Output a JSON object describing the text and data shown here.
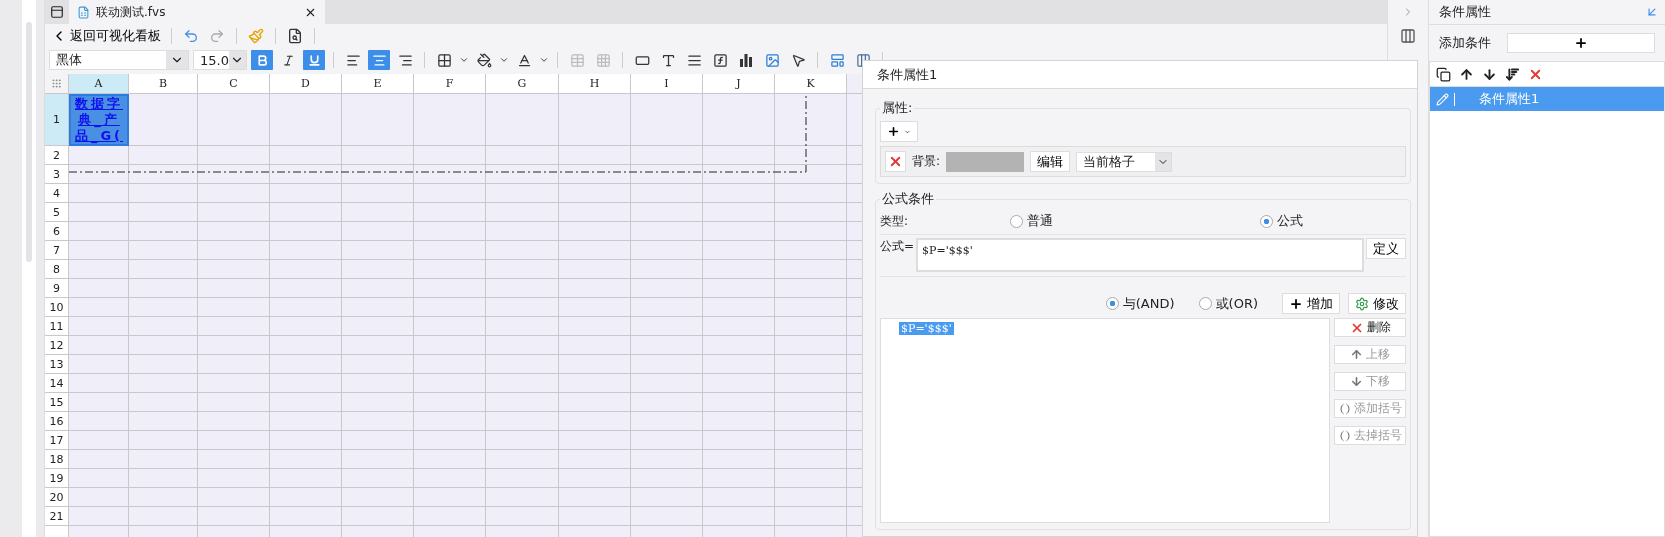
{
  "tab_bar": {
    "tabs": [
      {
        "label": "联动测试.fvs",
        "selected": true
      }
    ]
  },
  "toolbar": {
    "back_label": "返回可视化看板",
    "font_name": "黑体",
    "font_size": "15.0",
    "format_buttons": [
      {
        "kind": "bold",
        "selected": true
      },
      {
        "kind": "italic",
        "selected": false
      },
      {
        "kind": "underline",
        "selected": true
      }
    ],
    "align_buttons": [
      {
        "kind": "left",
        "selected": false
      },
      {
        "kind": "center",
        "selected": true
      },
      {
        "kind": "right",
        "selected": false
      }
    ]
  },
  "sheet": {
    "columns": [
      {
        "label": "A",
        "selected": true
      },
      {
        "label": "B",
        "selected": false
      },
      {
        "label": "C",
        "selected": false
      },
      {
        "label": "D",
        "selected": false
      },
      {
        "label": "E",
        "selected": false
      },
      {
        "label": "F",
        "selected": false
      },
      {
        "label": "G",
        "selected": false
      },
      {
        "label": "H",
        "selected": false
      },
      {
        "label": "I",
        "selected": false
      },
      {
        "label": "J",
        "selected": false
      },
      {
        "label": "K",
        "selected": false
      }
    ],
    "rows": [
      {
        "label": "1",
        "selected": true
      },
      {
        "label": "2",
        "selected": false
      },
      {
        "label": "3",
        "selected": false
      },
      {
        "label": "4",
        "selected": false
      },
      {
        "label": "5",
        "selected": false
      },
      {
        "label": "6",
        "selected": false
      },
      {
        "label": "7",
        "selected": false
      },
      {
        "label": "8",
        "selected": false
      },
      {
        "label": "9",
        "selected": false
      },
      {
        "label": "10",
        "selected": false
      },
      {
        "label": "11",
        "selected": false
      },
      {
        "label": "12",
        "selected": false
      },
      {
        "label": "13",
        "selected": false
      },
      {
        "label": "14",
        "selected": false
      },
      {
        "label": "15",
        "selected": false
      },
      {
        "label": "16",
        "selected": false
      },
      {
        "label": "17",
        "selected": false
      },
      {
        "label": "18",
        "selected": false
      },
      {
        "label": "19",
        "selected": false
      },
      {
        "label": "20",
        "selected": false
      },
      {
        "label": "21",
        "selected": false
      }
    ],
    "cell_a1": "数据字典_产品_G("
  },
  "dialog": {
    "title": "条件属性1",
    "attributes_label": "属性:",
    "attribute_rows": [
      {
        "label": "背景:",
        "color": "#b3b3b3",
        "edit": "编辑",
        "scope": "当前格子"
      }
    ],
    "formula_section": {
      "title": "公式条件",
      "type_label": "类型:",
      "types": [
        {
          "label": "普通",
          "selected": false
        },
        {
          "label": "公式",
          "selected": true
        }
      ],
      "formula_label": "公式=",
      "formula": "$P='$$$'",
      "define": "定义",
      "logic": [
        {
          "label": "与(AND)",
          "selected": true
        },
        {
          "label": "或(OR)",
          "selected": false
        }
      ],
      "add": "增加",
      "modify": "修改",
      "conditions": [
        {
          "text": "$P='$$$'",
          "selected": true
        }
      ],
      "actions": [
        {
          "kind": "delete",
          "label": "删除",
          "disabled": false
        },
        {
          "kind": "up",
          "label": "上移",
          "disabled": true
        },
        {
          "kind": "down",
          "label": "下移",
          "disabled": true
        },
        {
          "kind": "add_brackets",
          "label": "添加括号",
          "disabled": true
        },
        {
          "kind": "remove_brackets",
          "label": "去掉括号",
          "disabled": true
        }
      ]
    }
  },
  "right_panel": {
    "title": "条件属性",
    "add_label": "添加条件",
    "items": [
      {
        "label": "条件属性1",
        "selected": true
      }
    ]
  }
}
